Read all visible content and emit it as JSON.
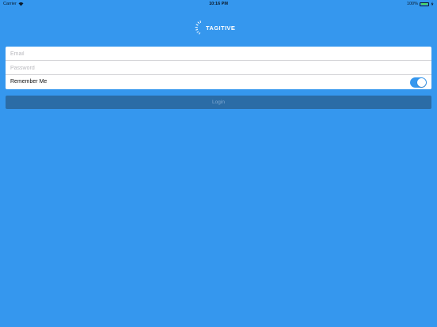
{
  "status_bar": {
    "carrier": "Carrier",
    "time": "10:16 PM",
    "battery_percent": "100%",
    "battery_level": 1.0
  },
  "logo": {
    "text": "TAGITIVE"
  },
  "form": {
    "email_placeholder": "Email",
    "email_value": "",
    "password_placeholder": "Password",
    "password_value": "",
    "remember_label": "Remember Me",
    "remember_on": true
  },
  "login_button": {
    "label": "Login"
  },
  "colors": {
    "background": "#3597ee",
    "button": "#2b6ca6",
    "toggle_on": "#3597ee"
  },
  "icons": [
    "wifi-icon",
    "battery-icon",
    "charge-icon",
    "tagitive-logo-icon"
  ]
}
